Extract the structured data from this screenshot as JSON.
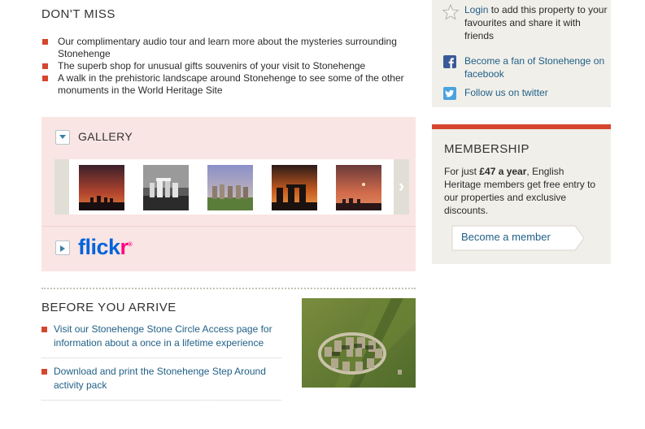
{
  "dont_miss": {
    "title": "DON'T MISS",
    "items": [
      "Our complimentary audio tour and learn more about the mysteries surrounding Stonehenge",
      "The superb shop for unusual gifts souvenirs of your visit to Stonehenge",
      "A walk in the prehistoric landscape around Stonehenge to see some of the other monuments in the World Heritage Site"
    ]
  },
  "gallery": {
    "title": "GALLERY",
    "toggle_icon": "chevron-down-icon",
    "next_glyph": "›",
    "next_icon": "chevron-right-icon"
  },
  "flickr": {
    "logo_part1": "flick",
    "logo_part2": "r",
    "logo_mark": "®",
    "toggle_icon": "triangle-right-icon",
    "brand_blue": "#0063dc",
    "brand_pink": "#ff0084"
  },
  "before_you_arrive": {
    "title": "BEFORE YOU ARRIVE",
    "items": [
      "Visit our Stonehenge Stone Circle Access page for information about a once in a lifetime experience",
      "Download and print the Stonehenge Step Around activity pack"
    ]
  },
  "social": {
    "login_link": "Login",
    "login_text": " to add this property to your favourites and share it with friends",
    "facebook_text": "Become a fan of Stonehenge on facebook",
    "twitter_text": "Follow us on twitter",
    "icons": [
      "star-icon",
      "facebook-icon",
      "twitter-icon"
    ]
  },
  "membership": {
    "title": "MEMBERSHIP",
    "text_prefix": "For just ",
    "price": "£47 a year",
    "text_suffix": ", English Heritage members get free entry to our properties and exclusive discounts.",
    "button_label": "Become a member"
  },
  "colors": {
    "accent_red": "#d4472e",
    "link_blue": "#1f5f86",
    "gallery_bg": "#f9e5e3",
    "sidebar_bg": "#f1efea"
  }
}
